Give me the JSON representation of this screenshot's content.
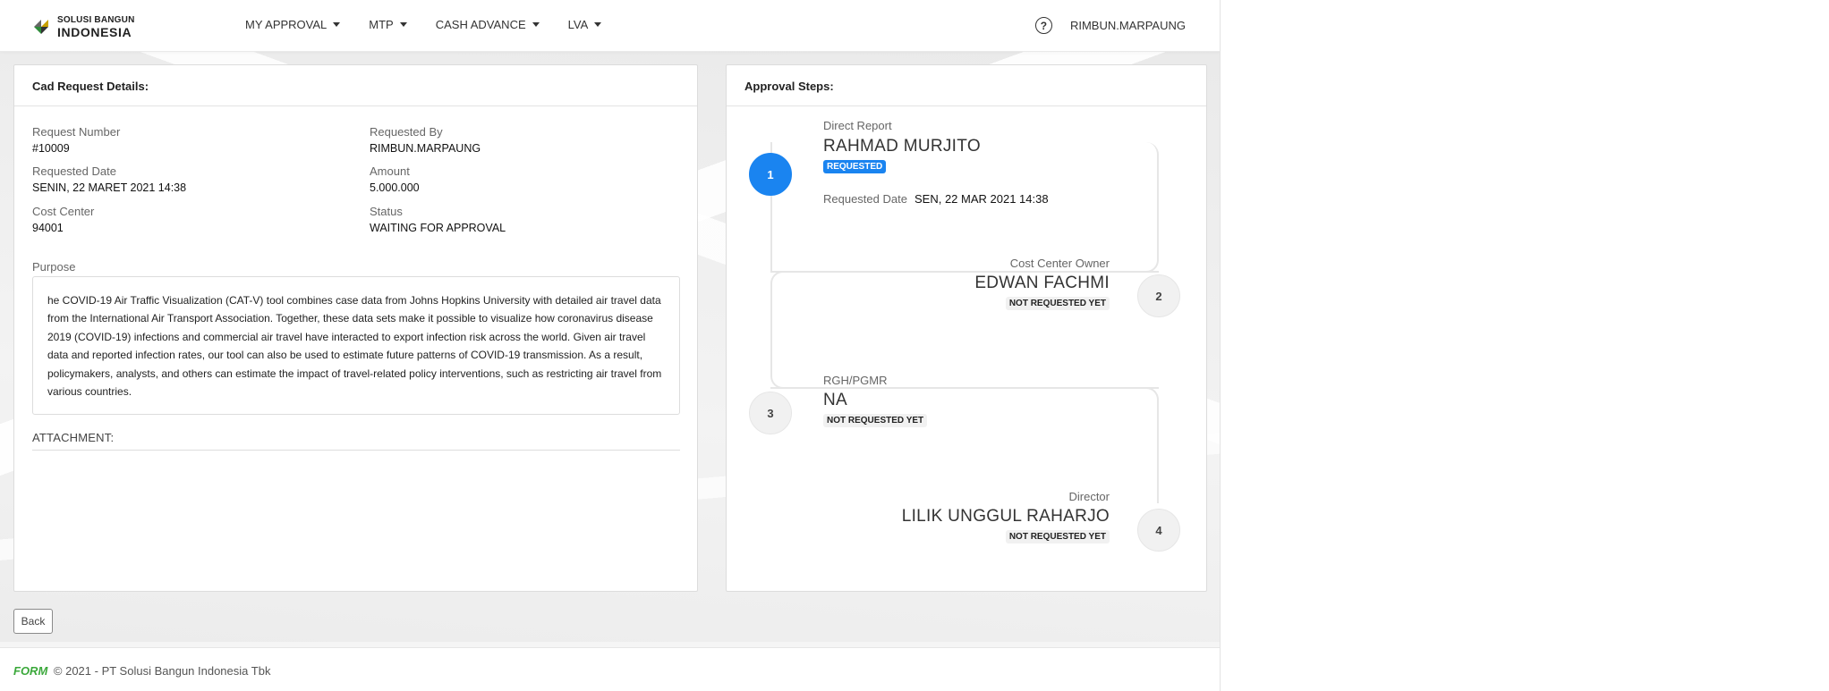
{
  "header": {
    "logo_line1": "SOLUSI BANGUN",
    "logo_line2": "INDONESIA",
    "nav": [
      {
        "label": "MY APPROVAL"
      },
      {
        "label": "MTP"
      },
      {
        "label": "CASH ADVANCE"
      },
      {
        "label": "LVA"
      }
    ],
    "help_glyph": "?",
    "username": "RIMBUN.MARPAUNG"
  },
  "details": {
    "title": "Cad Request Details:",
    "fields": [
      {
        "label": "Request Number",
        "value": "#10009"
      },
      {
        "label": "Requested By",
        "value": "RIMBUN.MARPAUNG"
      },
      {
        "label": "Requested Date",
        "value": "SENIN, 22 MARET 2021 14:38"
      },
      {
        "label": "Amount",
        "value": "5.000.000"
      },
      {
        "label": "Cost Center",
        "value": "94001"
      },
      {
        "label": "Status",
        "value": "WAITING FOR APPROVAL"
      }
    ],
    "purpose_label": "Purpose",
    "purpose_text": "he COVID-19 Air Traffic Visualization (CAT-V) tool combines case data from Johns Hopkins University with detailed air travel data from the International Air Transport Association. Together, these data sets make it possible to visualize how coronavirus disease 2019 (COVID-19) infections and commercial air travel have interacted to export infection risk across the world. Given air travel data and reported infection rates, our tool can also be used to estimate future patterns of COVID-19 transmission. As a result, policymakers, analysts, and others can estimate the impact of travel-related policy interventions, such as restricting air travel from various countries.",
    "attachment_label": "ATTACHMENT:"
  },
  "approval": {
    "title": "Approval Steps:",
    "steps": [
      {
        "number": "1",
        "role": "Direct Report",
        "name": "RAHMAD MURJITO",
        "status": "REQUESTED",
        "date_label": "Requested Date",
        "date_value": "SEN, 22 MAR 2021 14:38"
      },
      {
        "number": "2",
        "role": "Cost Center Owner",
        "name": "EDWAN FACHMI",
        "status": "NOT REQUESTED YET"
      },
      {
        "number": "3",
        "role": "RGH/PGMR",
        "name": "NA",
        "status": "NOT REQUESTED YET"
      },
      {
        "number": "4",
        "role": "Director",
        "name": "LILIK UNGGUL RAHARJO",
        "status": "NOT REQUESTED YET"
      }
    ]
  },
  "back_label": "Back",
  "footer": {
    "brand": "FORM",
    "text": "© 2021 - PT Solusi Bangun Indonesia Tbk"
  },
  "colors": {
    "accent": "#1a84f0",
    "footer_brand": "#3aa83a"
  }
}
